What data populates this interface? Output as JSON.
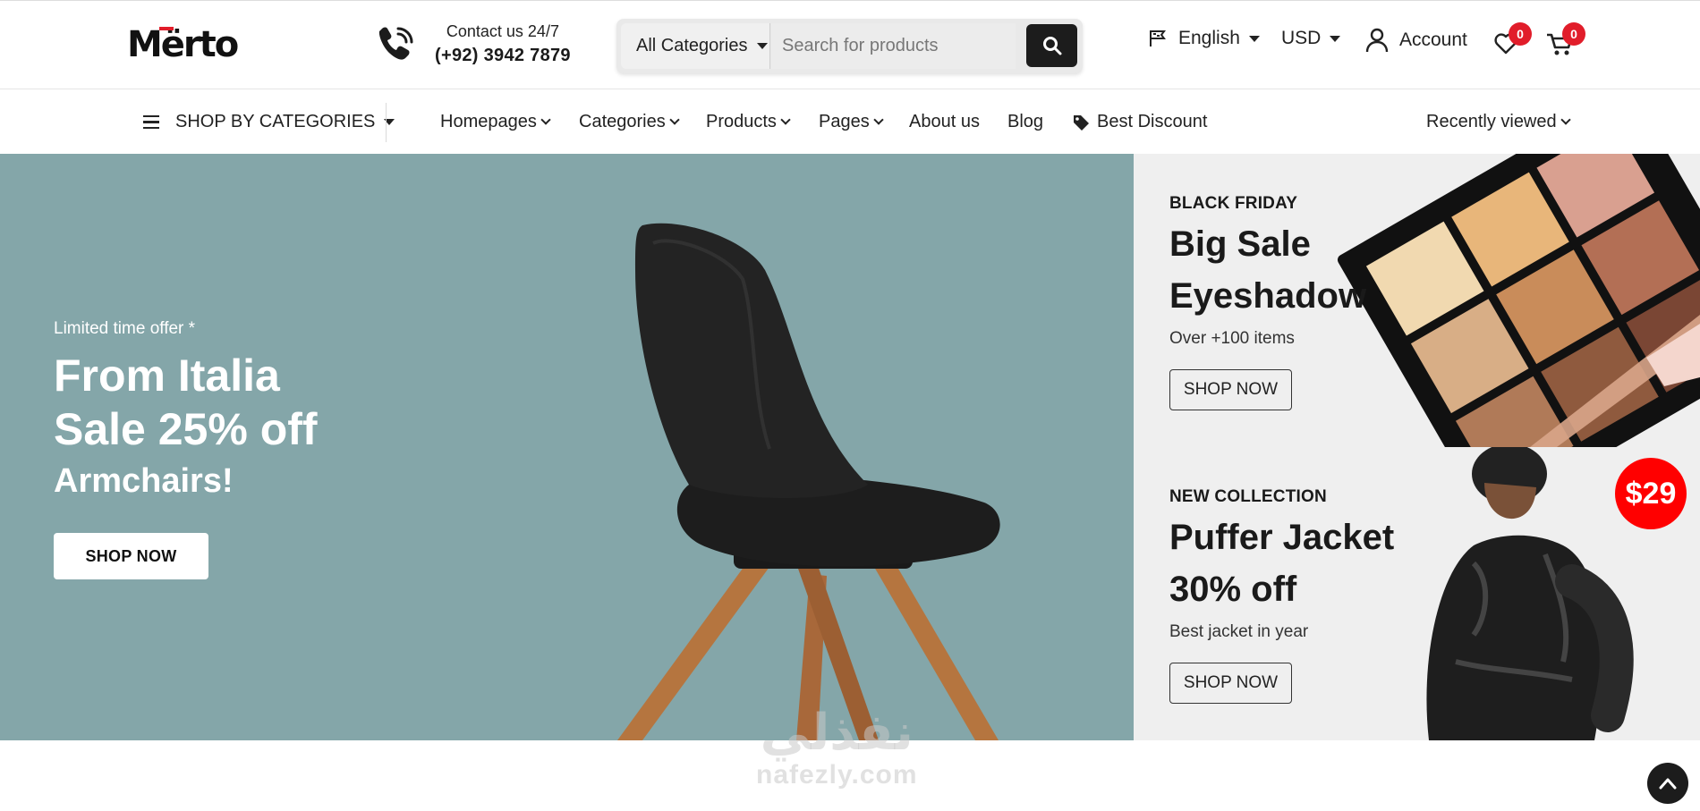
{
  "brand": {
    "logo_text": "Mërto",
    "accent": "#e11d2a"
  },
  "contact": {
    "label": "Contact us 24/7",
    "phone": "(+92) 3942 7879",
    "icon": "phone-icon"
  },
  "search": {
    "category": "All Categories",
    "placeholder": "Search for products",
    "icon": "search-icon"
  },
  "header": {
    "language": "English",
    "currency": "USD",
    "account_label": "Account",
    "wishlist_count": "0",
    "cart_count": "0"
  },
  "nav": {
    "shop_by_categories": "SHOP BY CATEGORIES",
    "items": [
      {
        "label": "Homepages",
        "dropdown": true
      },
      {
        "label": "Categories",
        "dropdown": true
      },
      {
        "label": "Products",
        "dropdown": true
      },
      {
        "label": "Pages",
        "dropdown": true
      },
      {
        "label": "About us",
        "dropdown": false
      },
      {
        "label": "Blog",
        "dropdown": false
      },
      {
        "label": "Best Discount",
        "dropdown": false,
        "icon": "tag-icon"
      }
    ],
    "recently_viewed": "Recently viewed"
  },
  "hero": {
    "kicker": "Limited time offer *",
    "title_line1": "From Italia",
    "title_line2": "Sale 25% off",
    "subtitle": "Armchairs!",
    "button": "SHOP NOW",
    "background": "#84a6a9"
  },
  "promos": [
    {
      "kicker": "BLACK FRIDAY",
      "title_line1": "Big Sale",
      "title_line2": "Eyeshadow",
      "sub": "Over +100 items",
      "button": "SHOP NOW"
    },
    {
      "kicker": "NEW COLLECTION",
      "title_line1": "Puffer Jacket",
      "title_line2": "30% off",
      "sub": "Best jacket in year",
      "button": "SHOP NOW",
      "price_badge": "$29"
    }
  ],
  "watermark": {
    "arabic": "نفذلي",
    "latin": "nafezly.com"
  }
}
